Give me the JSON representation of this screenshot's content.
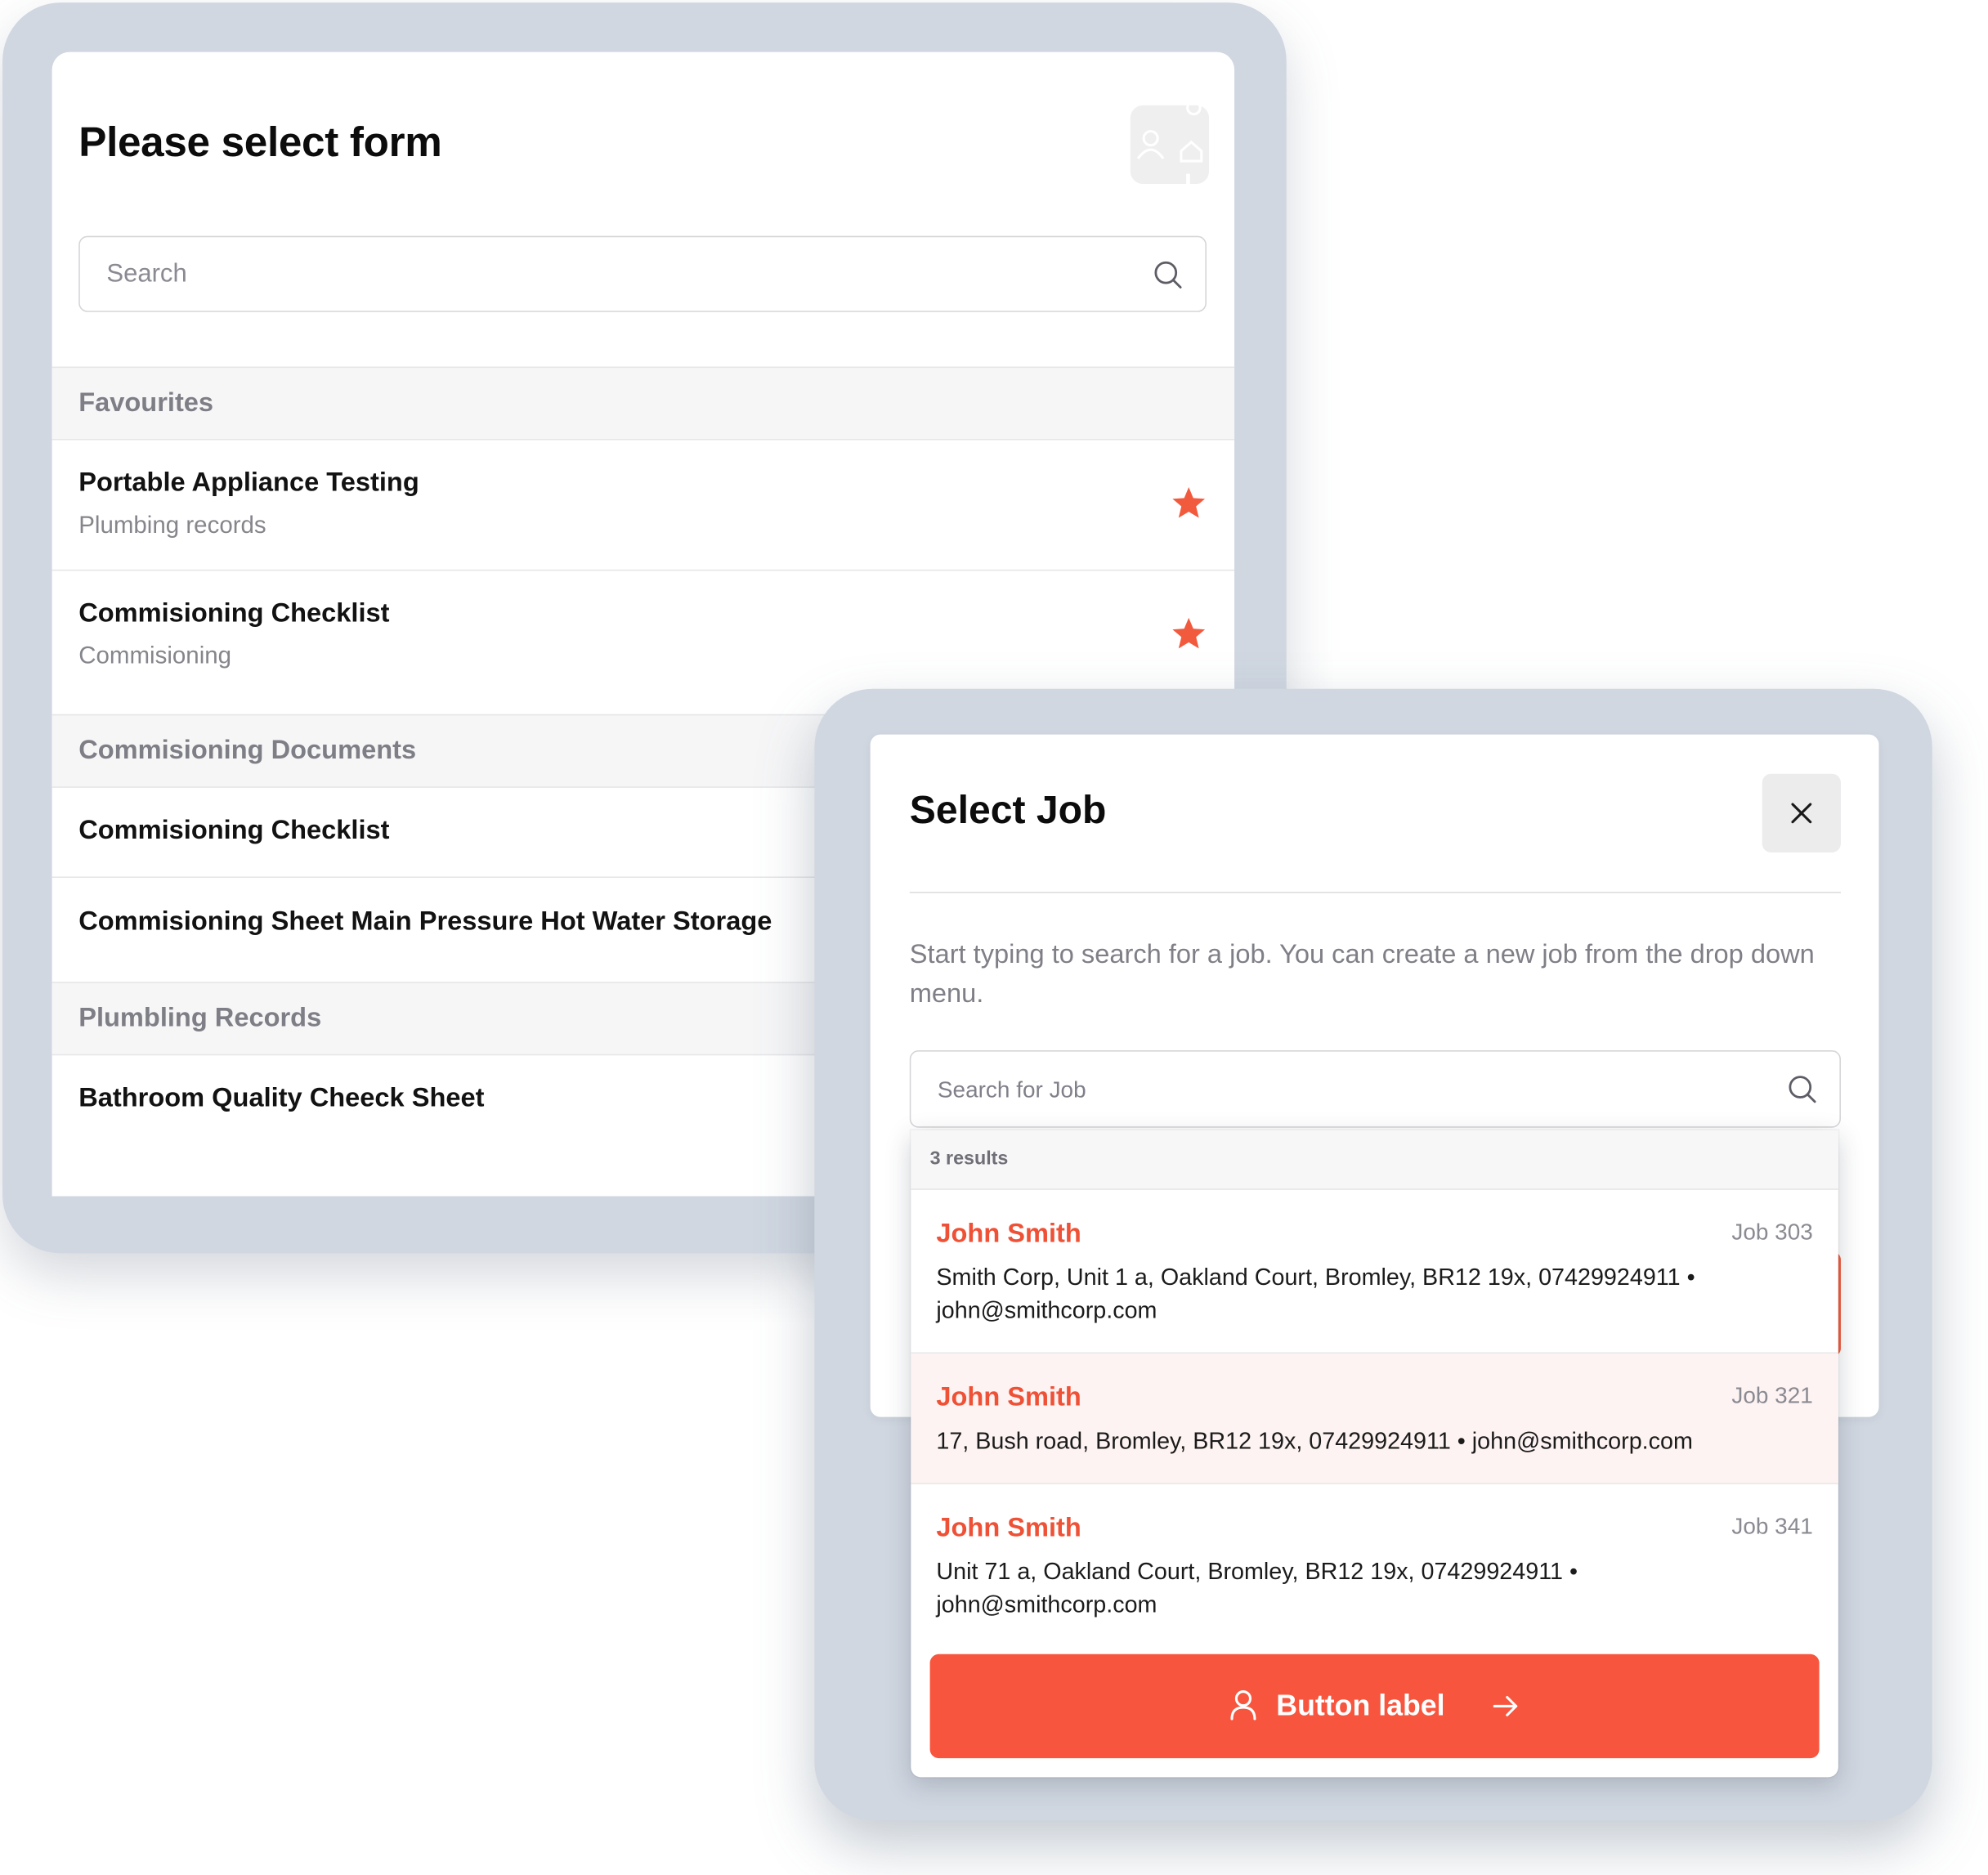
{
  "form_picker": {
    "title": "Please select form",
    "search_placeholder": "Search",
    "sections": [
      {
        "header": "Favourites",
        "items": [
          {
            "title": "Portable Appliance Testing",
            "subtitle": "Plumbing records",
            "favourite": true
          },
          {
            "title": "Commisioning Checklist",
            "subtitle": "Commisioning",
            "favourite": true
          }
        ]
      },
      {
        "header": "Commisioning Documents",
        "items": [
          {
            "title": "Commisioning Checklist"
          },
          {
            "title": "Commisioning Sheet Main Pressure Hot Water Storage"
          }
        ]
      },
      {
        "header": "Plumbling Records",
        "items": [
          {
            "title": "Bathroom Quality Cheeck Sheet"
          }
        ]
      }
    ]
  },
  "job_modal": {
    "title": "Select Job",
    "description": "Start typing to search for a job. You can create a new job from the drop down menu.",
    "search_placeholder": "Search for Job",
    "results_count": "3 results",
    "results": [
      {
        "name": "John Smith",
        "job": "Job 303",
        "details": "Smith Corp, Unit 1 a, Oakland Court, Bromley, BR12 19x, 07429924911 • john@smithcorp.com"
      },
      {
        "name": "John Smith",
        "job": "Job 321",
        "details": "17, Bush road, Bromley, BR12 19x, 07429924911 • john@smithcorp.com",
        "highlighted": true
      },
      {
        "name": "John Smith",
        "job": "Job 341",
        "details": "Unit 71 a, Oakland Court, Bromley, BR12 19x, 07429924911 • john@smithcorp.com"
      }
    ],
    "button_label": "Button label"
  },
  "colors": {
    "accent": "#f7553e",
    "accent_text": "#ee5136",
    "frame": "#d0d7e1",
    "section_bg": "#f6f6f7",
    "highlight_row": "#fdf3f2"
  },
  "icons": {
    "avatar": "user-home-icon",
    "search": "search-icon",
    "favourite": "star-icon",
    "close": "close-icon",
    "button_leading": "user-icon",
    "button_trailing": "arrow-right-icon"
  }
}
